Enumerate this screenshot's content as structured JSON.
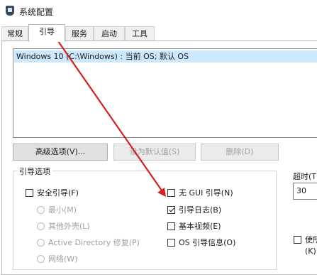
{
  "window": {
    "title": "系统配置",
    "icon": "msconfig-icon"
  },
  "tabs": [
    {
      "label": "常规",
      "active": false
    },
    {
      "label": "引导",
      "active": true
    },
    {
      "label": "服务",
      "active": false
    },
    {
      "label": "启动",
      "active": false
    },
    {
      "label": "工具",
      "active": false
    }
  ],
  "os_list": {
    "entries": [
      "Windows 10 (C:\\Windows) : 当前 OS; 默认 OS"
    ],
    "selected_index": 0
  },
  "buttons": {
    "advanced": "高级选项(V)...",
    "set_default": "设为默认值(S)",
    "delete": "删除(D)"
  },
  "boot_options": {
    "title": "引导选项",
    "safe_boot": {
      "label": "安全引导(F)",
      "checked": false
    },
    "safe_modes": [
      "最小(M)",
      "其他外壳(L)",
      "Active Directory 修复(P)",
      "网络(W)"
    ],
    "no_gui_boot": {
      "label": "无 GUI 引导(N)",
      "checked": false
    },
    "boot_log": {
      "label": "引导日志(B)",
      "checked": true
    },
    "base_video": {
      "label": "基本视频(E)",
      "checked": false
    },
    "os_boot_info": {
      "label": "OS 引导信息(O)",
      "checked": false
    }
  },
  "timeout": {
    "label": "超时(T",
    "value": "30"
  },
  "permanent": {
    "label": "使所",
    "label_line2": "(K)"
  },
  "annotation": {
    "arrow_color": "#d42020"
  }
}
